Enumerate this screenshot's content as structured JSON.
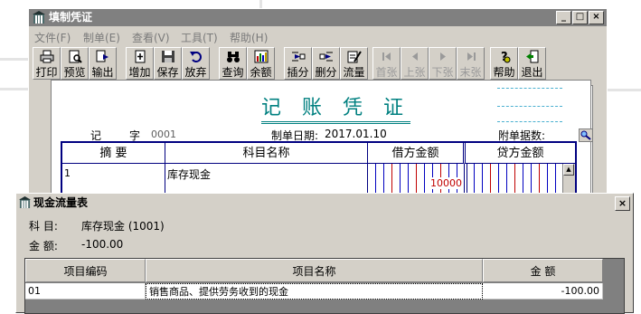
{
  "main_window": {
    "title": "填制凭证",
    "menu": [
      "文件(F)",
      "制单(E)",
      "查看(V)",
      "工具(T)",
      "帮助(H)"
    ],
    "toolbar": [
      {
        "label": "打印",
        "icon": "printer-icon",
        "enabled": true
      },
      {
        "label": "预览",
        "icon": "preview-icon",
        "enabled": true
      },
      {
        "label": "输出",
        "icon": "export-icon",
        "enabled": true
      },
      {
        "label": "增加",
        "icon": "add-icon",
        "enabled": true
      },
      {
        "label": "保存",
        "icon": "save-icon",
        "enabled": true
      },
      {
        "label": "放弃",
        "icon": "undo-icon",
        "enabled": true
      },
      {
        "label": "查询",
        "icon": "binoculars-icon",
        "enabled": true
      },
      {
        "label": "余额",
        "icon": "balance-chart-icon",
        "enabled": true
      },
      {
        "label": "插分",
        "icon": "insert-row-icon",
        "enabled": true
      },
      {
        "label": "删分",
        "icon": "delete-row-icon",
        "enabled": true
      },
      {
        "label": "流量",
        "icon": "flow-edit-icon",
        "enabled": true
      },
      {
        "label": "首张",
        "icon": "first-icon",
        "enabled": false
      },
      {
        "label": "上张",
        "icon": "previous-icon",
        "enabled": false
      },
      {
        "label": "下张",
        "icon": "next-icon",
        "enabled": false
      },
      {
        "label": "末张",
        "icon": "last-icon",
        "enabled": false
      },
      {
        "label": "帮助",
        "icon": "help-icon",
        "enabled": true
      },
      {
        "label": "退出",
        "icon": "exit-icon",
        "enabled": true
      }
    ]
  },
  "voucher": {
    "title": "记 账 凭 证",
    "type_label": "记",
    "number_label": "字",
    "number": "0001",
    "date_label": "制单日期:",
    "date": "2017.01.10",
    "attachments_label": "附单据数:",
    "headers": [
      "摘 要",
      "科目名称",
      "借方金额",
      "贷方金额"
    ],
    "row": {
      "index": "1",
      "account": "库存现金",
      "debit": "10000"
    }
  },
  "dialog": {
    "title": "现金流量表",
    "subject_label": "科 目:",
    "subject_value": "库存现金 (1001)",
    "amount_label": "金 额:",
    "amount_value": "-100.00",
    "columns": [
      "项目编码",
      "项目名称",
      "金 额"
    ],
    "rows": [
      {
        "code": "01",
        "name": "销售商品、提供劳务收到的现金",
        "amount": "-100.00"
      }
    ]
  },
  "colors": {
    "title_inactive": "#808080",
    "accent": "#008080",
    "grid_border": "#000080",
    "link_text": "#0000c0"
  }
}
